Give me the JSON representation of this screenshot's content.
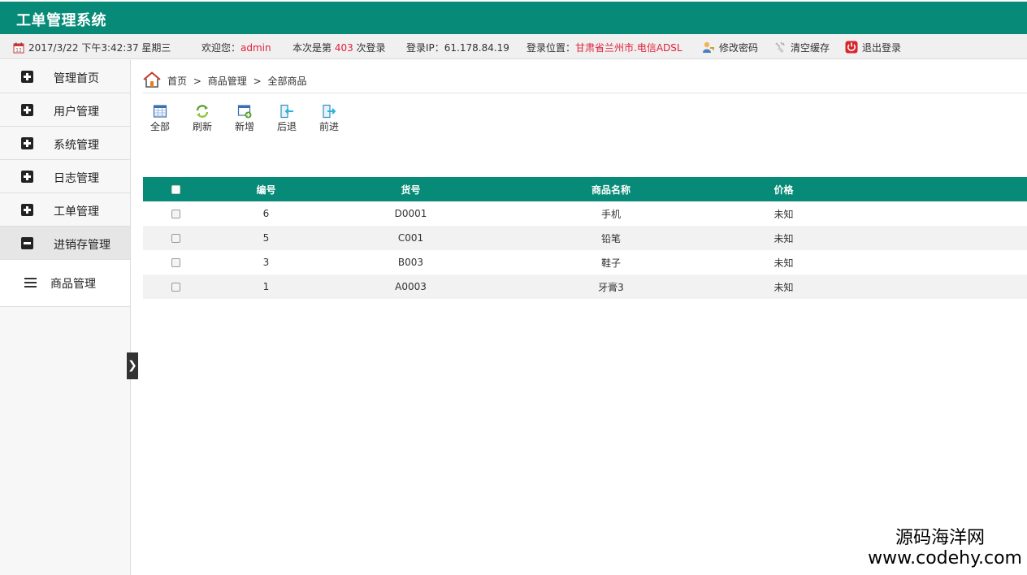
{
  "app": {
    "title": "工单管理系统"
  },
  "infobar": {
    "datetime": "2017/3/22 下午3:42:37 星期三",
    "welcome_prefix": "欢迎您：",
    "username": "admin",
    "login_count_prefix": "本次是第 ",
    "login_count": "403",
    "login_count_suffix": " 次登录",
    "login_ip": "登录IP：61.178.84.19",
    "location_prefix": "登录位置：",
    "location": "甘肃省兰州市.电信ADSL",
    "change_password": "修改密码",
    "clear_cache": "清空缓存",
    "logout": "退出登录",
    "highlight_color": "#e0213a"
  },
  "sidebar": {
    "items": [
      {
        "label": "管理首页",
        "icon": "plus-square-icon"
      },
      {
        "label": "用户管理",
        "icon": "plus-square-icon"
      },
      {
        "label": "系统管理",
        "icon": "plus-square-icon"
      },
      {
        "label": "日志管理",
        "icon": "plus-square-icon"
      },
      {
        "label": "工单管理",
        "icon": "plus-square-icon"
      },
      {
        "label": "进销存管理",
        "icon": "minus-square-icon"
      }
    ],
    "subitems": [
      {
        "label": "商品管理",
        "icon": "list-icon"
      }
    ],
    "toggle": "❯"
  },
  "breadcrumb": {
    "home": "首页",
    "section": "商品管理",
    "current": "全部商品",
    "separator": ">"
  },
  "toolbar": {
    "all": "全部",
    "refresh": "刷新",
    "add": "新增",
    "back": "后退",
    "forward": "前进"
  },
  "table": {
    "headers": [
      "编号",
      "货号",
      "商品名称",
      "价格"
    ],
    "rows": [
      {
        "id": "6",
        "code": "D0001",
        "name": "手机",
        "price": "未知"
      },
      {
        "id": "5",
        "code": "C001",
        "name": "铅笔",
        "price": "未知"
      },
      {
        "id": "3",
        "code": "B003",
        "name": "鞋子",
        "price": "未知"
      },
      {
        "id": "1",
        "code": "A0003",
        "name": "牙膏3",
        "price": "未知"
      }
    ]
  },
  "watermark": {
    "line1": "源码海洋网",
    "line2": "www.codehy.com"
  },
  "colors": {
    "brand": "#078a77"
  }
}
